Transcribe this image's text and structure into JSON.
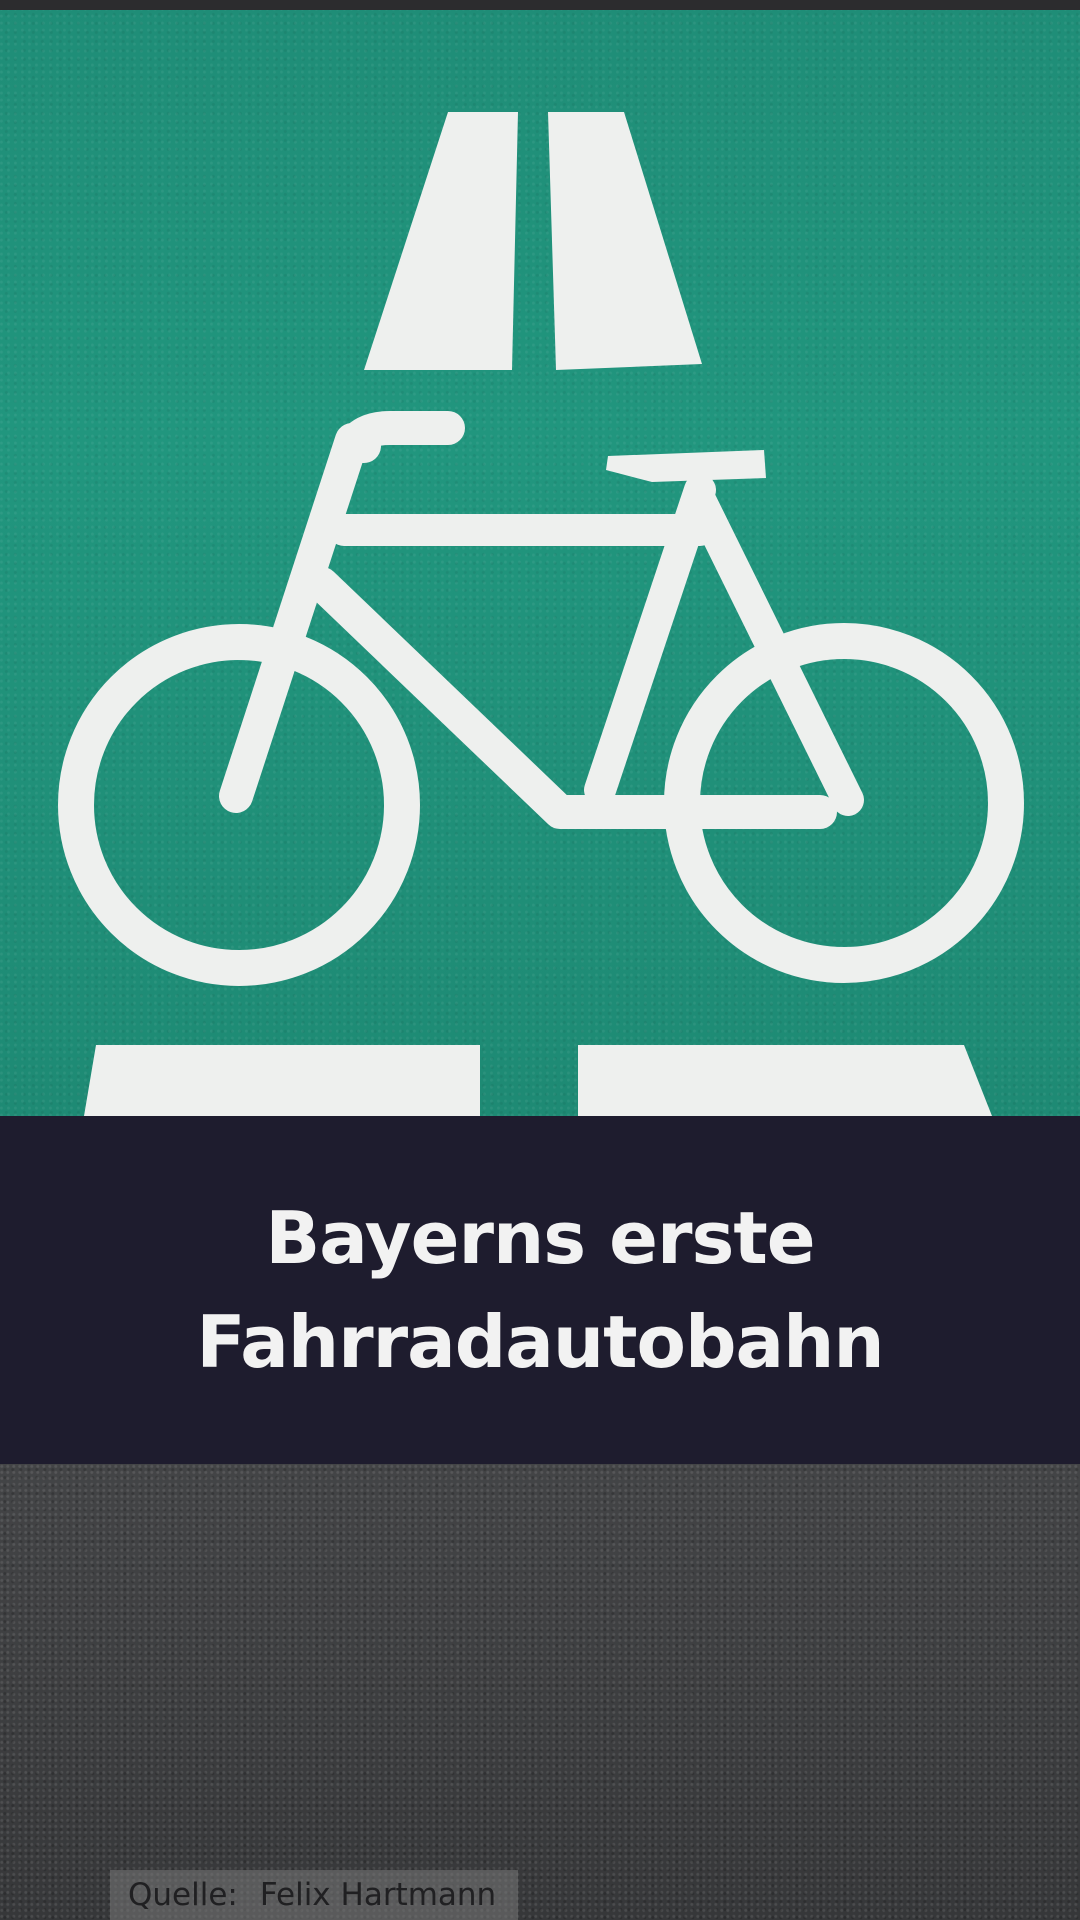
{
  "headline": {
    "line1": "Bayerns erste",
    "line2": "Fahrradautobahn"
  },
  "credit": {
    "label": "Quelle:",
    "author": "Felix Hartmann"
  },
  "colors": {
    "sign_green": "#21967e",
    "banner_navy": "#1e1c2e",
    "headline_text": "#f2f2f2",
    "asphalt": "#3c3d3f"
  },
  "icons": [
    "bicycle-pictogram-icon",
    "road-lane-markings-icon"
  ]
}
